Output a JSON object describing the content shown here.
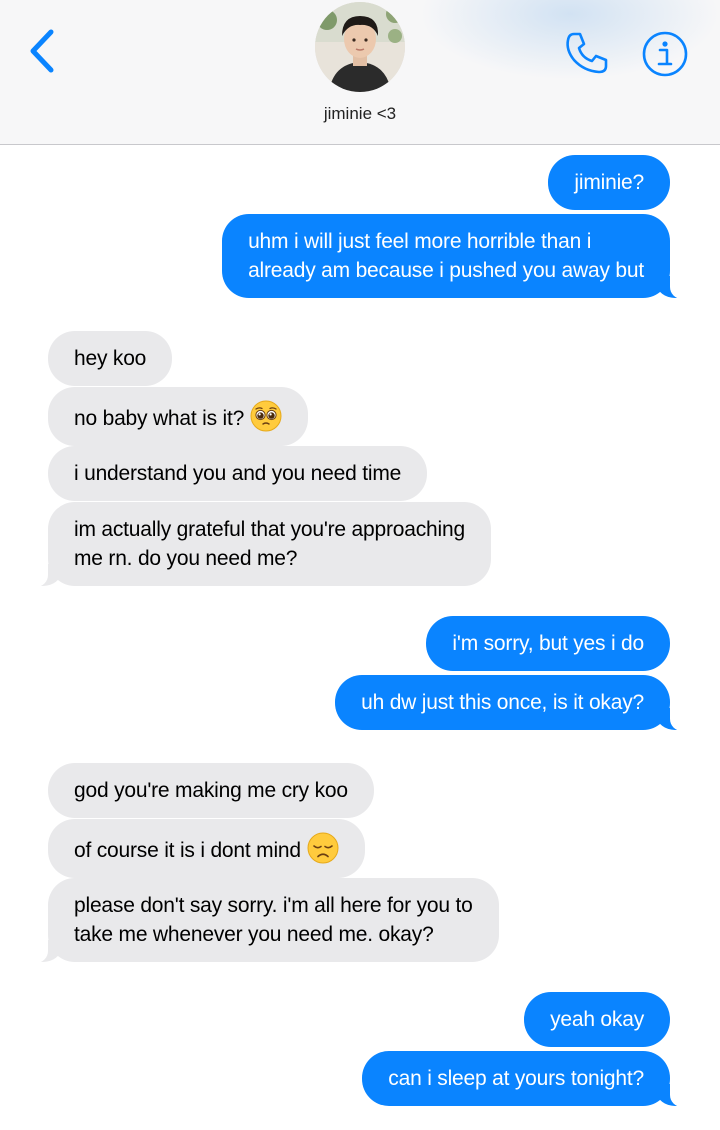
{
  "header": {
    "contact_name": "jiminie <3",
    "icons": [
      "back-chevron-icon",
      "contact-avatar",
      "phone-icon",
      "info-icon"
    ],
    "accent_color": "#0a84ff"
  },
  "messages": [
    {
      "from": "me",
      "lines": [
        "jiminie?"
      ]
    },
    {
      "from": "me",
      "lines": [
        "uhm i will just feel more horrible than i",
        "already am because i pushed you away but"
      ]
    },
    {
      "from": "contact",
      "lines": [
        "hey koo"
      ]
    },
    {
      "from": "contact",
      "lines": [
        "no baby what is it?"
      ],
      "emoji": "pleading-face-emoji"
    },
    {
      "from": "contact",
      "lines": [
        "i understand you and you need time"
      ]
    },
    {
      "from": "contact",
      "lines": [
        "im actually grateful that you're approaching",
        "me rn. do you need me?"
      ]
    },
    {
      "from": "me",
      "lines": [
        "i'm sorry, but yes i do"
      ]
    },
    {
      "from": "me",
      "lines": [
        "uh dw just this once, is it okay?"
      ]
    },
    {
      "from": "contact",
      "lines": [
        "god you're making me cry koo"
      ]
    },
    {
      "from": "contact",
      "lines": [
        "of course it is i dont mind"
      ],
      "emoji": "disappointed-face-emoji"
    },
    {
      "from": "contact",
      "lines": [
        "please don't say sorry. i'm all here for you to",
        "take me whenever you need me. okay?"
      ]
    },
    {
      "from": "me",
      "lines": [
        "yeah okay"
      ]
    },
    {
      "from": "me",
      "lines": [
        "can i sleep at yours tonight?"
      ]
    }
  ],
  "colors": {
    "outgoing_bubble": "#0a84ff",
    "incoming_bubble": "#e9e9eb",
    "header_background": "#f7f7f8"
  }
}
